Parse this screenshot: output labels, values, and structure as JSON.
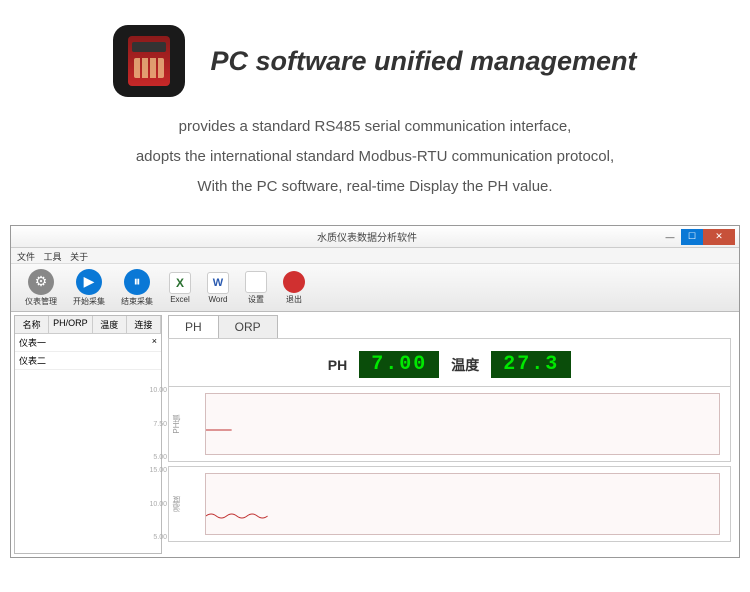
{
  "header": {
    "title": "PC software unified management"
  },
  "description": {
    "line1": "provides a standard RS485 serial communication interface,",
    "line2": "adopts the international standard Modbus-RTU communication protocol,",
    "line3": "With the PC software, real-time Display the PH value."
  },
  "window": {
    "title": "水质仪表数据分析软件",
    "min": "—",
    "max": "☐",
    "close": "✕"
  },
  "menu": {
    "file": "文件",
    "tools": "工具",
    "about": "关于"
  },
  "toolbar": {
    "items": [
      {
        "label": "仪表管理"
      },
      {
        "label": "开始采集"
      },
      {
        "label": "结束采集"
      },
      {
        "label": "Excel"
      },
      {
        "label": "Word"
      },
      {
        "label": "设置"
      },
      {
        "label": "退出"
      }
    ]
  },
  "sidebar": {
    "cols": [
      "名称",
      "PH/ORP",
      "温度",
      "连接"
    ],
    "rows": [
      {
        "name": "仪表一",
        "conn": "×"
      },
      {
        "name": "仪表二",
        "conn": ""
      }
    ]
  },
  "tabs": {
    "ph": "PH",
    "orp": "ORP"
  },
  "readings": {
    "ph_label": "PH",
    "ph_value": "7.00",
    "temp_label": "温度",
    "temp_value": "27.3"
  },
  "chart_data": [
    {
      "type": "line",
      "ylabel": "PH值",
      "ylim": [
        5,
        10
      ],
      "ticks": [
        "10.00",
        "7.50",
        "5.00"
      ],
      "values_desc": "flat line ~7.0 on left 5%, no data after",
      "series": [
        {
          "name": "PH",
          "values": [
            7.0,
            7.0,
            7.0
          ]
        }
      ]
    },
    {
      "type": "line",
      "ylabel": "温度",
      "ylim": [
        5,
        15
      ],
      "ticks": [
        "15.00",
        "10.00",
        "5.00"
      ],
      "values_desc": "small oscillation ~8 on left 10%, no data after",
      "series": [
        {
          "name": "温度",
          "values": [
            8,
            8.3,
            7.8,
            8.2,
            7.9,
            8.1,
            8
          ]
        }
      ]
    }
  ]
}
